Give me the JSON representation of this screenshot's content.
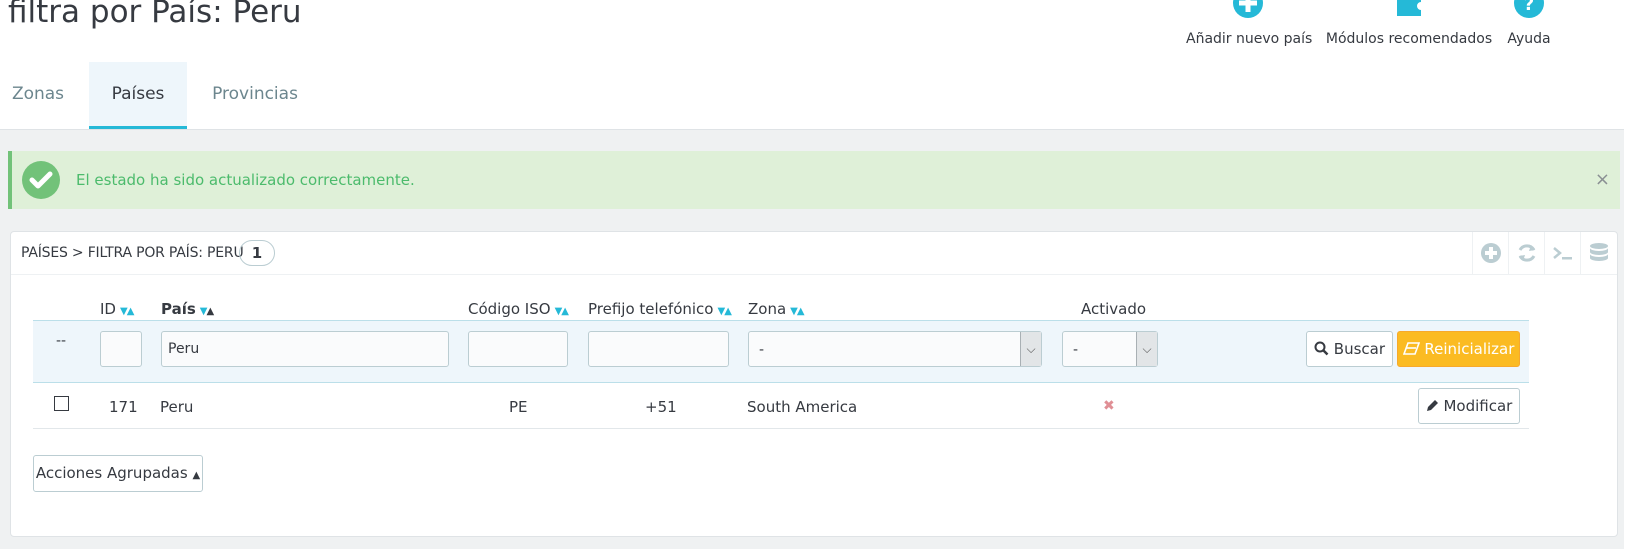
{
  "header": {
    "title": "filtra por País: Peru",
    "toolbar": [
      {
        "label": "Añadir nuevo país",
        "icon": "plus-circle-icon"
      },
      {
        "label": "Módulos recomendados",
        "icon": "puzzle-icon"
      },
      {
        "label": "Ayuda",
        "icon": "help-circle-icon"
      }
    ]
  },
  "tabs": [
    {
      "label": "Zonas",
      "active": false
    },
    {
      "label": "Países",
      "active": true
    },
    {
      "label": "Provincias",
      "active": false
    }
  ],
  "alert": {
    "message": "El estado ha sido actualizado correctamente.",
    "close": "×"
  },
  "panel": {
    "title": "PAÍSES > FILTRA POR PAÍS: PERU",
    "count": "1",
    "tools": [
      "add-icon",
      "refresh-icon",
      "sql-query-icon",
      "export-database-icon"
    ]
  },
  "table": {
    "columns": {
      "id": "ID",
      "country": "País",
      "iso": "Código ISO",
      "prefix": "Prefijo telefónico",
      "zone": "Zona",
      "active": "Activado"
    },
    "filters": {
      "bulk_placeholder": "--",
      "id": "",
      "country": "Peru",
      "iso": "",
      "prefix": "",
      "zone": "-",
      "active": "-",
      "search_button": "Buscar",
      "reset_button": "Reinicializar"
    },
    "rows": [
      {
        "id": "171",
        "country": "Peru",
        "iso": "PE",
        "prefix": "+51",
        "zone": "South America",
        "active": "✖",
        "edit_button": "Modificar"
      }
    ]
  },
  "bulk_actions": {
    "label": "Acciones Agrupadas"
  },
  "colors": {
    "accent": "#25b9d7",
    "success": "#72c279",
    "warning": "#fbbb22",
    "error": "#e08f95"
  }
}
